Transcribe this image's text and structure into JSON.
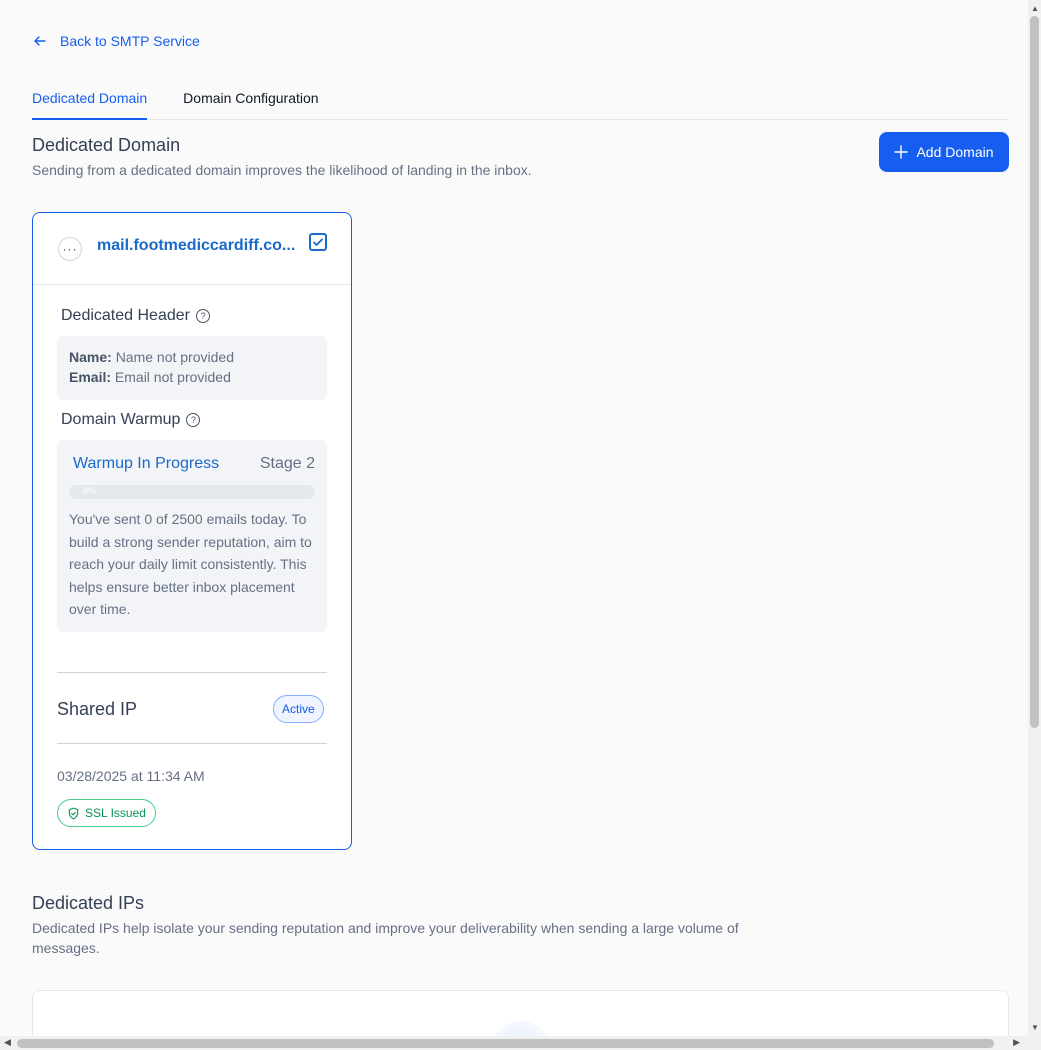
{
  "back_link": {
    "label": "Back to SMTP Service",
    "icon": "arrow-left-icon"
  },
  "tabs": [
    {
      "label": "Dedicated Domain",
      "active": true
    },
    {
      "label": "Domain Configuration",
      "active": false
    }
  ],
  "dedicated_domain": {
    "title": "Dedicated Domain",
    "subtitle": "Sending from a dedicated domain improves the likelihood of landing in the inbox.",
    "add_button": "Add Domain"
  },
  "domain_card": {
    "more_icon": "···",
    "domain": "mail.footmediccardiff.co...",
    "selected": true,
    "header_section": {
      "title": "Dedicated Header",
      "name_label": "Name:",
      "name_value": "Name not provided",
      "email_label": "Email:",
      "email_value": "Email not provided"
    },
    "warmup_section": {
      "title": "Domain Warmup",
      "status": "Warmup In Progress",
      "stage": "Stage 2",
      "progress_label": "0%",
      "progress_fraction": 0,
      "description": "You've sent 0 of 2500 emails today. To build a strong sender reputation, aim to reach your daily limit consistently. This helps ensure better inbox placement over time."
    },
    "ip_type": "Shared IP",
    "ip_status": "Active",
    "created": "03/28/2025 at 11:34 AM",
    "ssl_badge": "SSL Issued"
  },
  "dedicated_ips": {
    "title": "Dedicated IPs",
    "subtitle": "Dedicated IPs help isolate your sending reputation and improve your deliverability when sending a large volume of messages."
  },
  "colors": {
    "primary": "#155eef",
    "link": "#1a6acb",
    "success": "#079455",
    "muted": "#667085"
  }
}
